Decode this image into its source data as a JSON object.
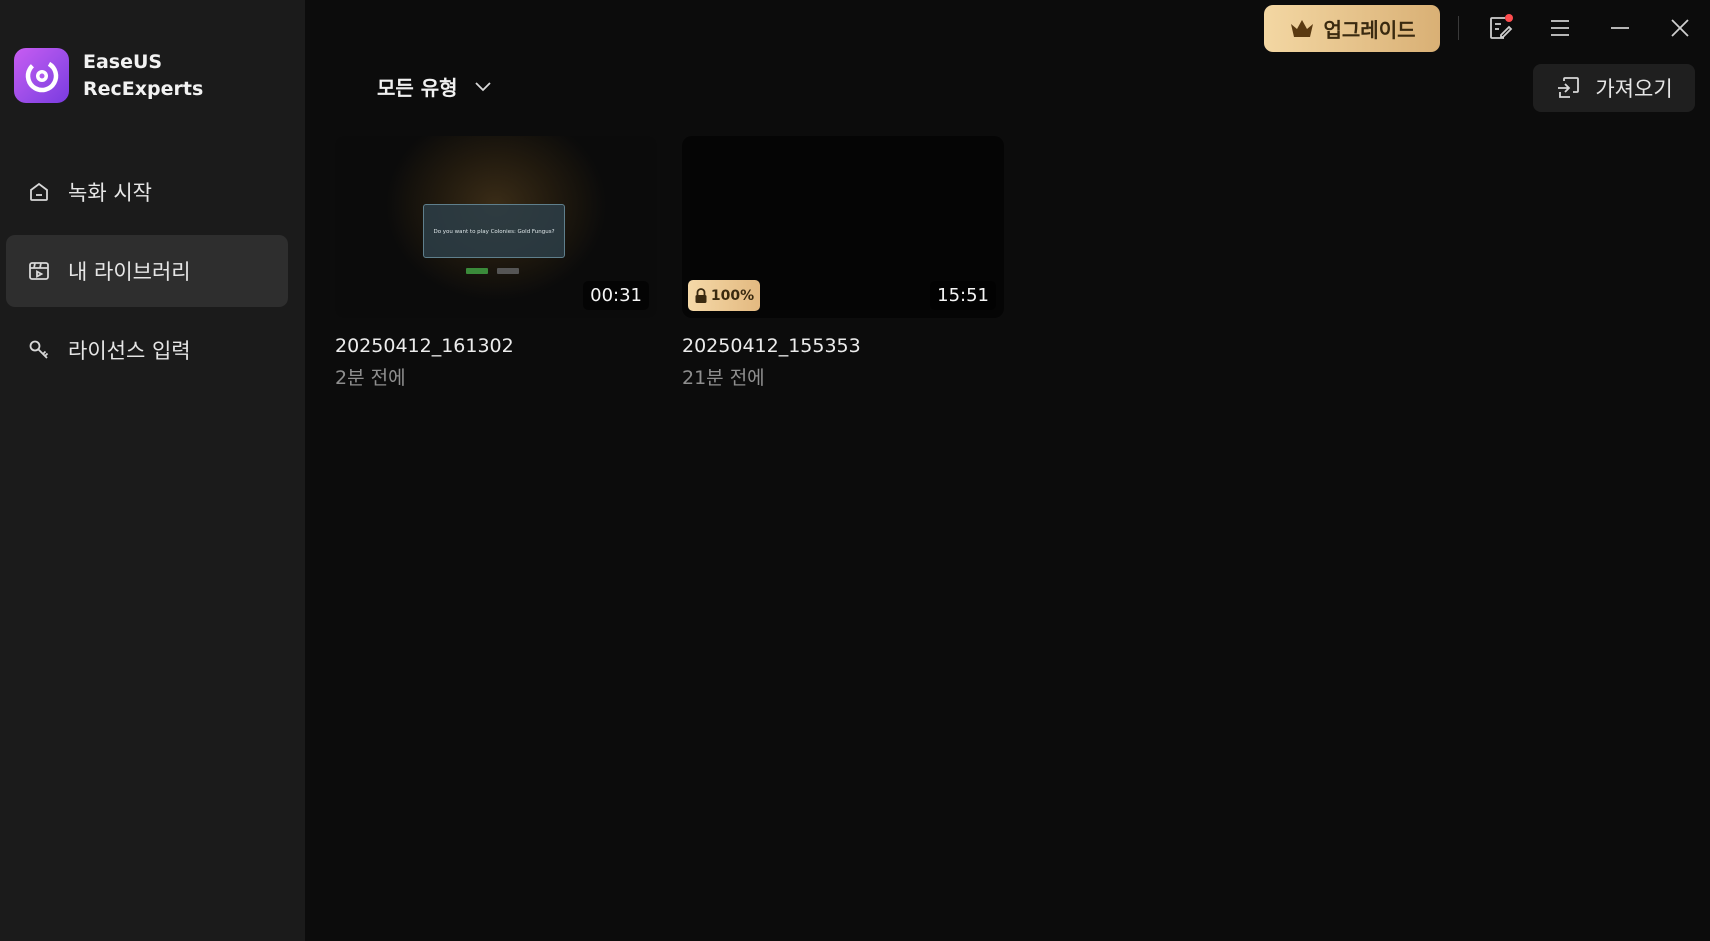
{
  "app": {
    "name_line1": "EaseUS",
    "name_line2": "RecExperts"
  },
  "sidebar": {
    "items": [
      {
        "label": "녹화 시작",
        "icon": "home-icon",
        "active": false
      },
      {
        "label": "내 라이브러리",
        "icon": "library-icon",
        "active": true
      },
      {
        "label": "라이선스 입력",
        "icon": "key-icon",
        "active": false
      }
    ]
  },
  "topbar": {
    "upgrade_label": "업그레이드",
    "icons": [
      "crown-icon",
      "notes-icon",
      "menu-icon",
      "minimize-icon",
      "close-icon"
    ]
  },
  "library": {
    "filter_label": "모든 유형",
    "import_label": "가져오기",
    "items": [
      {
        "title": "20250412_161302",
        "time_ago": "2분 전에",
        "duration": "00:31",
        "thumbnail_text": "Do you want to play Colonies: Gold Fungus?"
      },
      {
        "title": "20250412_155353",
        "time_ago": "21분 전에",
        "duration": "15:51",
        "badge": "100%"
      }
    ]
  },
  "colors": {
    "accent_gold": "#e3b980",
    "sidebar_bg": "#1b1b1b",
    "main_bg": "#0c0c0c",
    "logo_purple": "#9b4de8"
  }
}
